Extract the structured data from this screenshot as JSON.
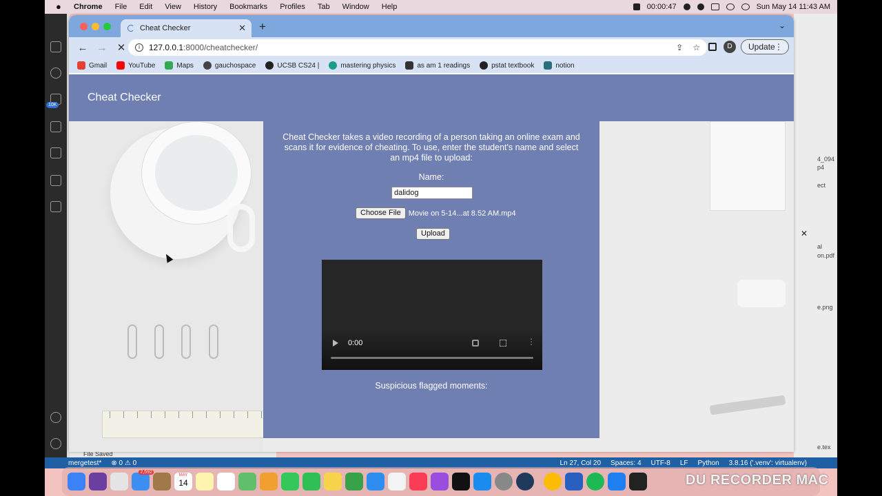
{
  "menubar": {
    "app": "Chrome",
    "items": [
      "File",
      "Edit",
      "View",
      "History",
      "Bookmarks",
      "Profiles",
      "Tab",
      "Window",
      "Help"
    ],
    "recording_time": "00:00:47",
    "datetime": "Sun May 14  11:43 AM"
  },
  "browser": {
    "tab_title": "Cheat Checker",
    "url_host": "127.0.0.1",
    "url_rest": ":8000/cheatchecker/",
    "profile_initial": "D",
    "update_label": "Update",
    "bookmarks": [
      {
        "label": "Gmail",
        "color": "#e44134"
      },
      {
        "label": "YouTube",
        "color": "#ff0000"
      },
      {
        "label": "Maps",
        "color": "#34a853"
      },
      {
        "label": "gauchospace",
        "color": "#444444"
      },
      {
        "label": "UCSB CS24 |",
        "color": "#222222"
      },
      {
        "label": "mastering physics",
        "color": "#1a9c8c"
      },
      {
        "label": "as am 1 readings",
        "color": "#333333"
      },
      {
        "label": "pstat textbook",
        "color": "#222222"
      },
      {
        "label": "notion",
        "color": "#2a6f7a"
      }
    ]
  },
  "page": {
    "brand": "Cheat Checker",
    "description": "Cheat Checker takes a video recording of a person taking an online exam and scans it for evidence of cheating. To use, enter the student's name and select an mp4 file to upload:",
    "name_label": "Name:",
    "name_value": "dalidog",
    "choose_file_label": "Choose File",
    "file_name": "Movie on 5-14...at 8.52 AM.mp4",
    "upload_label": "Upload",
    "video_time": "0:00",
    "flagged_label": "Suspicious flagged moments:"
  },
  "vscode": {
    "badge_count": "10K",
    "file_saved": "File Saved",
    "branch": "mergetest*",
    "problems": "⊗ 0 ⚠ 0",
    "cursor_pos": "Ln 27, Col 20",
    "spaces": "Spaces: 4",
    "encoding": "UTF-8",
    "eol": "LF",
    "language": "Python",
    "interpreter": "3.8.16 ('.venv': virtualenv)"
  },
  "finder": {
    "labels": [
      "4_094",
      "p4",
      "ect",
      "al",
      "on.pdf",
      "e.png",
      "e.tex"
    ]
  },
  "dock": {
    "calendar_day": "14",
    "calendar_month": "MAY",
    "mail_badge": "2,592",
    "watermark": "DU RECORDER MAC"
  },
  "colors": {
    "navbar": "#6f7fb2",
    "tabstrip": "#7ea7dd",
    "toolbar": "#d7e3f5"
  }
}
